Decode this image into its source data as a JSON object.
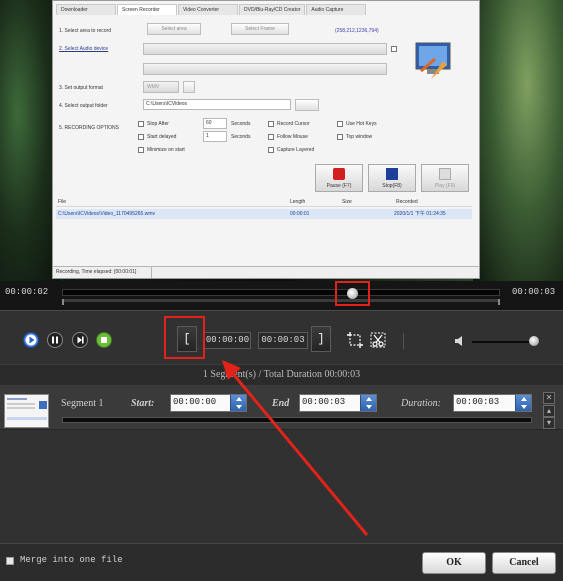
{
  "app": {
    "tabs": [
      "Downloader",
      "Screen Recorder",
      "Video Converter",
      "DVD/Blu-Ray/CD Creator",
      "Audio Capture"
    ],
    "rows": {
      "area": "1. Select area to record",
      "area_btn1": "Select area",
      "area_btn2": "Select Frame",
      "area_value": "(258,212,1236,794)",
      "audio": "2. Select Audio device",
      "format": "3. Set output format",
      "format_value": "WMV",
      "folder": "4. Select output folder",
      "folder_value": "C:\\Users\\ICVideos",
      "settings": "5. RECORDING OPTIONS"
    },
    "options": {
      "stop_after": "Stop After",
      "stop_after_value": "60",
      "seconds": "Seconds",
      "start_delayed": "Start delayed",
      "start_delayed_value": "1",
      "minimize": "Minimize on start",
      "record_cursor": "Record Cursor",
      "follow_mouse": "Follow Mouse",
      "capture_layered": "Capture Layered",
      "use_hotkeys": "Use Hot Keys",
      "top_window": "Top window"
    },
    "buttons": {
      "pause": "Pause (F7)",
      "stop": "Stop(F8)",
      "play": "Play (F9)"
    },
    "file_headers": {
      "file": "File",
      "length": "Length",
      "size": "Size",
      "recorded": "Recorded"
    },
    "file_row": {
      "file": "C:\\Users\\ICVideos\\Video_1170495265.wmv",
      "length": "00:00:01",
      "recorded": "2020/1/1 下午 01:24:35"
    },
    "status": "Recording, Time elapsed: [00:00:01]"
  },
  "timeline": {
    "start": "00:00:02",
    "end": "00:00:03",
    "position_fraction": 0.65
  },
  "controls": {
    "start_time": "00:00:00",
    "end_time": "00:00:03",
    "left_bracket": "[",
    "right_bracket": "]",
    "volume_fraction": 0.95
  },
  "summary": "1 Segment(s) / Total Duration 00:00:03",
  "segment": {
    "name": "Segment 1",
    "start_label": "Start:",
    "start_value": "00:00:00",
    "end_label": "End",
    "end_value": "00:00:03",
    "duration_label": "Duration:",
    "duration_value": "00:00:03"
  },
  "footer": {
    "merge_label": "Merge into one file",
    "ok": "OK",
    "cancel": "Cancel"
  },
  "colors": {
    "highlight": "#e3231a",
    "accent_blue": "#2f62ad"
  }
}
